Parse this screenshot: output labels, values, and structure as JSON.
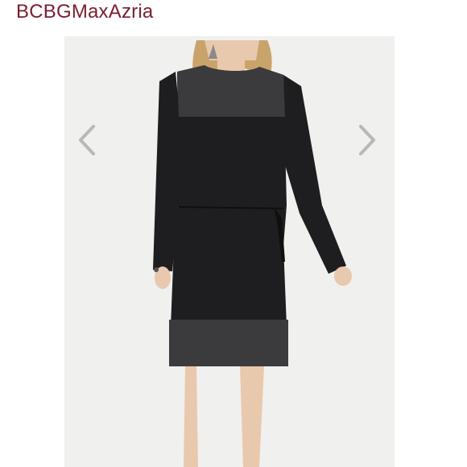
{
  "header": {
    "brand": "BCBGMaxAzria"
  },
  "gallery": {
    "prev_icon": "chevron-left-icon",
    "next_icon": "chevron-right-icon",
    "image_subject": "model-in-black-dress",
    "colors": {
      "brand": "#7a2030",
      "dress": "#1e1e20",
      "sheer": "#3b3b3e",
      "backdrop": "#f0f0ee",
      "arrow": "#b8b8b8",
      "skin": "#e8c9ae",
      "hair": "#c9a46a"
    }
  }
}
